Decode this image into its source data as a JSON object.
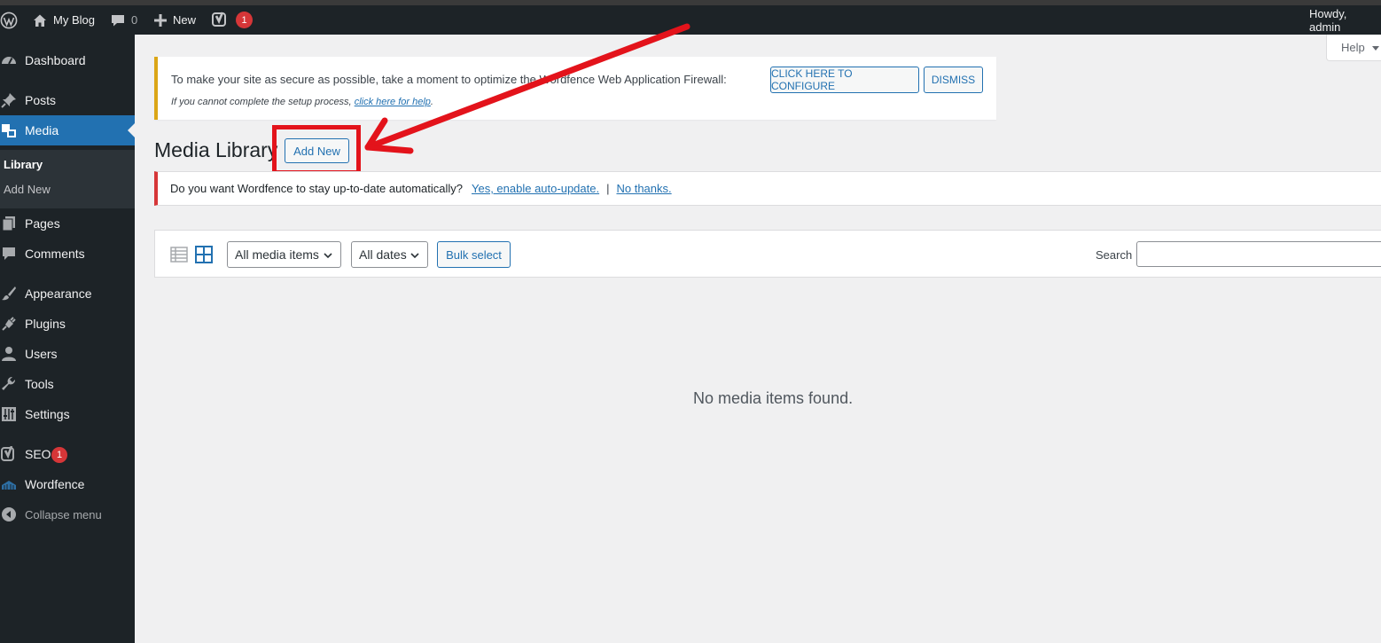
{
  "admin_bar": {
    "site_name": "My Blog",
    "comments_count": "0",
    "new_label": "New",
    "yoast_badge": "1",
    "greeting": "Howdy, admin"
  },
  "sidebar": {
    "items": [
      {
        "label": "Dashboard",
        "icon": "dashboard-icon"
      },
      {
        "label": "Posts",
        "icon": "pin-icon"
      },
      {
        "label": "Media",
        "icon": "media-icon"
      },
      {
        "label": "Pages",
        "icon": "pages-icon"
      },
      {
        "label": "Comments",
        "icon": "comment-icon"
      },
      {
        "label": "Appearance",
        "icon": "brush-icon"
      },
      {
        "label": "Plugins",
        "icon": "plug-icon"
      },
      {
        "label": "Users",
        "icon": "user-icon"
      },
      {
        "label": "Tools",
        "icon": "wrench-icon"
      },
      {
        "label": "Settings",
        "icon": "sliders-icon"
      },
      {
        "label": "SEO",
        "icon": "yoast-icon",
        "badge": "1"
      },
      {
        "label": "Wordfence",
        "icon": "wordfence-icon"
      }
    ],
    "submenu": [
      "Library",
      "Add New"
    ],
    "collapse_label": "Collapse menu"
  },
  "help_tab": "Help",
  "firewall_notice": {
    "message": "To make your site as secure as possible, take a moment to optimize the Wordfence Web Application Firewall:",
    "configure_button": "CLICK HERE TO CONFIGURE",
    "dismiss_button": "DISMISS",
    "help_prefix": "If you cannot complete the setup process,",
    "help_link": "click here for help",
    "help_suffix": "."
  },
  "page": {
    "title": "Media Library",
    "add_new_button": "Add New"
  },
  "update_notice": {
    "question": "Do you want Wordfence to stay up-to-date automatically?",
    "yes_link": "Yes, enable auto-update.",
    "separator": "|",
    "no_link": "No thanks."
  },
  "toolbar": {
    "filter_type": "All media items",
    "filter_date": "All dates",
    "bulk_select": "Bulk select",
    "search_label": "Search",
    "search_value": ""
  },
  "empty_message": "No media items found.",
  "colors": {
    "accent": "#2271b1",
    "admin_dark": "#1d2327",
    "annotation_red": "#e3131b"
  }
}
